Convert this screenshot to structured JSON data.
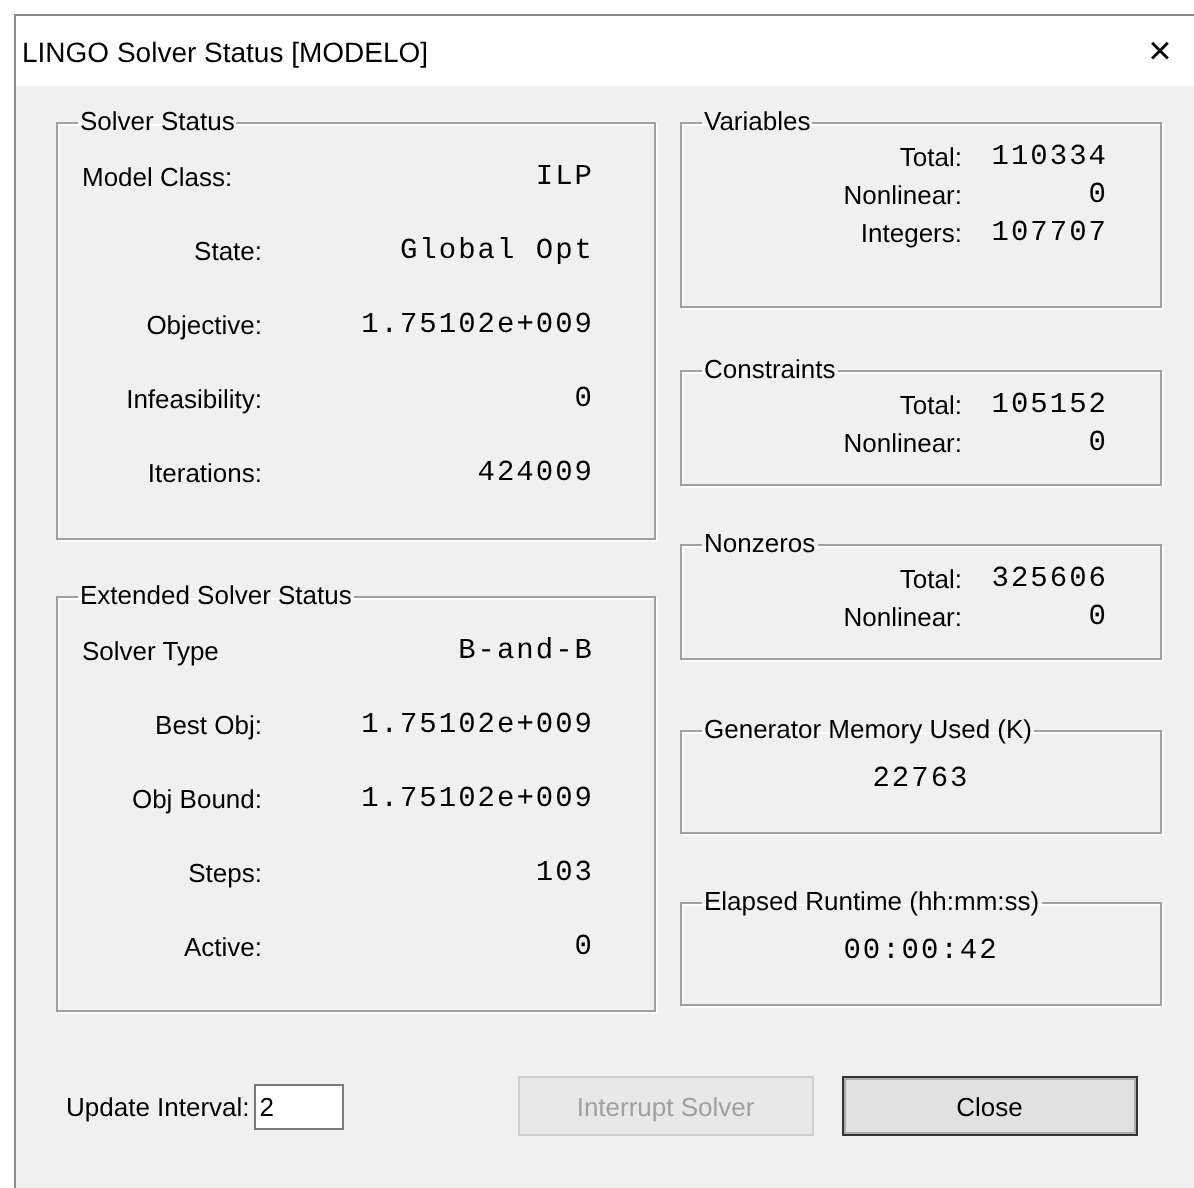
{
  "window": {
    "title": "LINGO Solver Status [MODELO]",
    "close": "×"
  },
  "left_groups": [
    {
      "title": "Solver Status",
      "rows": [
        {
          "label": "Model Class:",
          "value": "ILP"
        },
        {
          "label": "State:",
          "value": "Global Opt"
        },
        {
          "label": "Objective:",
          "value": "1.75102e+009"
        },
        {
          "label": "Infeasibility:",
          "value": "0"
        },
        {
          "label": "Iterations:",
          "value": "424009"
        }
      ]
    },
    {
      "title": "Extended Solver Status",
      "rows": [
        {
          "label": "Solver Type",
          "value": "B-and-B"
        },
        {
          "label": "Best Obj:",
          "value": "1.75102e+009"
        },
        {
          "label": "Obj Bound:",
          "value": "1.75102e+009"
        },
        {
          "label": "Steps:",
          "value": "103"
        },
        {
          "label": "Active:",
          "value": "0"
        }
      ]
    }
  ],
  "right_groups": [
    {
      "title": "Variables",
      "rows": [
        {
          "label": "Total:",
          "value": "110334"
        },
        {
          "label": "Nonlinear:",
          "value": "0"
        },
        {
          "label": "Integers:",
          "value": "107707"
        }
      ]
    },
    {
      "title": "Constraints",
      "rows": [
        {
          "label": "Total:",
          "value": "105152"
        },
        {
          "label": "Nonlinear:",
          "value": "0"
        }
      ]
    },
    {
      "title": "Nonzeros",
      "rows": [
        {
          "label": "Total:",
          "value": "325606"
        },
        {
          "label": "Nonlinear:",
          "value": "0"
        }
      ]
    },
    {
      "title": "Generator Memory Used (K)",
      "value": "22763"
    },
    {
      "title": "Elapsed Runtime (hh:mm:ss)",
      "value": "00:00:42"
    }
  ],
  "update_interval": {
    "label": "Update Interval:",
    "value": "2"
  },
  "buttons": [
    {
      "label": "Interrupt Solver",
      "disabled": true
    },
    {
      "label": "Close",
      "disabled": false
    }
  ]
}
